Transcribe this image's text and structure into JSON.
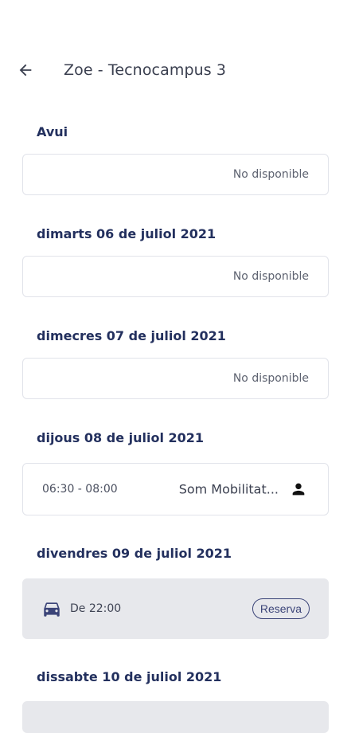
{
  "header": {
    "title": "Zoe - Tecnocampus 3"
  },
  "days": [
    {
      "label": "Avui",
      "status": "No disponible"
    },
    {
      "label": "dimarts 06 de juliol 2021",
      "status": "No disponible"
    },
    {
      "label": "dimecres 07 de juliol 2021",
      "status": "No disponible"
    },
    {
      "label": "dijous 08 de juliol 2021",
      "time": "06:30 - 08:00",
      "name": "Som Mobilitat..."
    },
    {
      "label": "divendres 09 de juliol 2021",
      "time": "De 22:00",
      "action": "Reserva"
    },
    {
      "label": "dissabte 10 de juliol 2021"
    }
  ],
  "colors": {
    "navy": "#23305e",
    "card_border": "#e1e3ea",
    "grey_card": "#e7e8ec",
    "car_icon": "#3b4478"
  }
}
